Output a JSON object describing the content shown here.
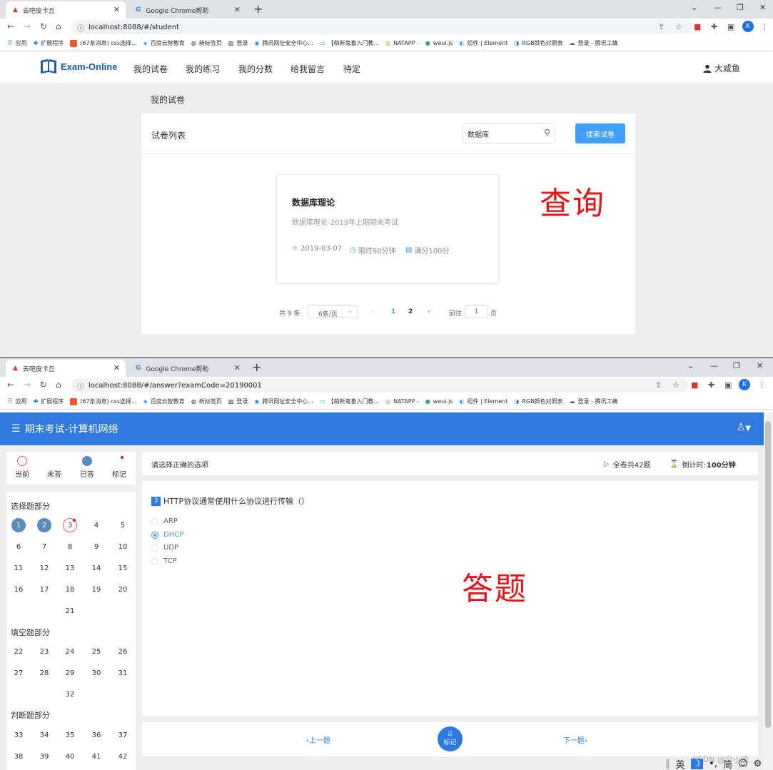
{
  "window1": {
    "tab_active": "去吧皮卡丘",
    "tab_other": "Google Chrome帮助",
    "url": "localhost:8088/#/student",
    "bookmarks": [
      "应用",
      "扩展程序",
      "(67条消息) css选择...",
      "百度云智教育",
      "新标签页",
      "登录",
      "腾讯网址安全中心...",
      "【萌新鬼畜入门教...",
      "NATAPP -",
      "weui.js",
      "组件 | Element",
      "RGB颜色对照表",
      "登录 - 腾讯工蜂"
    ],
    "logo_text": "Exam-Online",
    "nav": [
      "我的试卷",
      "我的练习",
      "我的分数",
      "给我留言",
      "待定"
    ],
    "user": "大咸鱼",
    "breadcrumb": "我的试卷",
    "panel_title": "试卷列表",
    "search_value": "数据库",
    "search_button": "搜索试卷",
    "card": {
      "title": "数据库理论",
      "desc": "数据库理论-2019年上期期末考试",
      "date": "2019-03-07",
      "time_limit": "限时90分钟",
      "full_score": "满分100分"
    },
    "annotation": "查询",
    "pager": {
      "total": "共 9 条",
      "size": "6条/页",
      "pages": [
        "1",
        "2"
      ],
      "goto_label": "前往",
      "goto_value": "1",
      "page_unit": "页"
    }
  },
  "window2": {
    "tab_active": "去吧皮卡丘",
    "tab_other": "Google Chrome帮助",
    "url": "localhost:8088/#/answer?examCode=20190001",
    "exam_title": "期末考试-计算机网络",
    "legend": [
      "当前",
      "未答",
      "已答",
      "标记"
    ],
    "sections": [
      {
        "title": "选择题部分",
        "start": 1,
        "end": 21
      },
      {
        "title": "填空题部分",
        "start": 22,
        "end": 32
      },
      {
        "title": "判断题部分",
        "start": 33,
        "end": 42
      }
    ],
    "answered": [
      1,
      2
    ],
    "current": 3,
    "instruction": "请选择正确的选项",
    "total_label": "全卷共42题",
    "countdown_label": "倒计时:",
    "countdown_value": "100分钟",
    "question_index": "3",
    "question_text": "HTTP协议通常使用什么协议进行传输（）",
    "options": [
      "ARP",
      "DHCP",
      "UDP",
      "TCP"
    ],
    "selected_option": 1,
    "annotation": "答题",
    "prev": "上一题",
    "next": "下一题",
    "mark": "标记",
    "ime": [
      "英",
      "简"
    ],
    "watermark": "CSDN @宁小流"
  },
  "colors": {
    "primary": "#2e7ae0",
    "button": "#409eff",
    "annotation": "#e8141a",
    "answered": "#5b8bbd"
  }
}
